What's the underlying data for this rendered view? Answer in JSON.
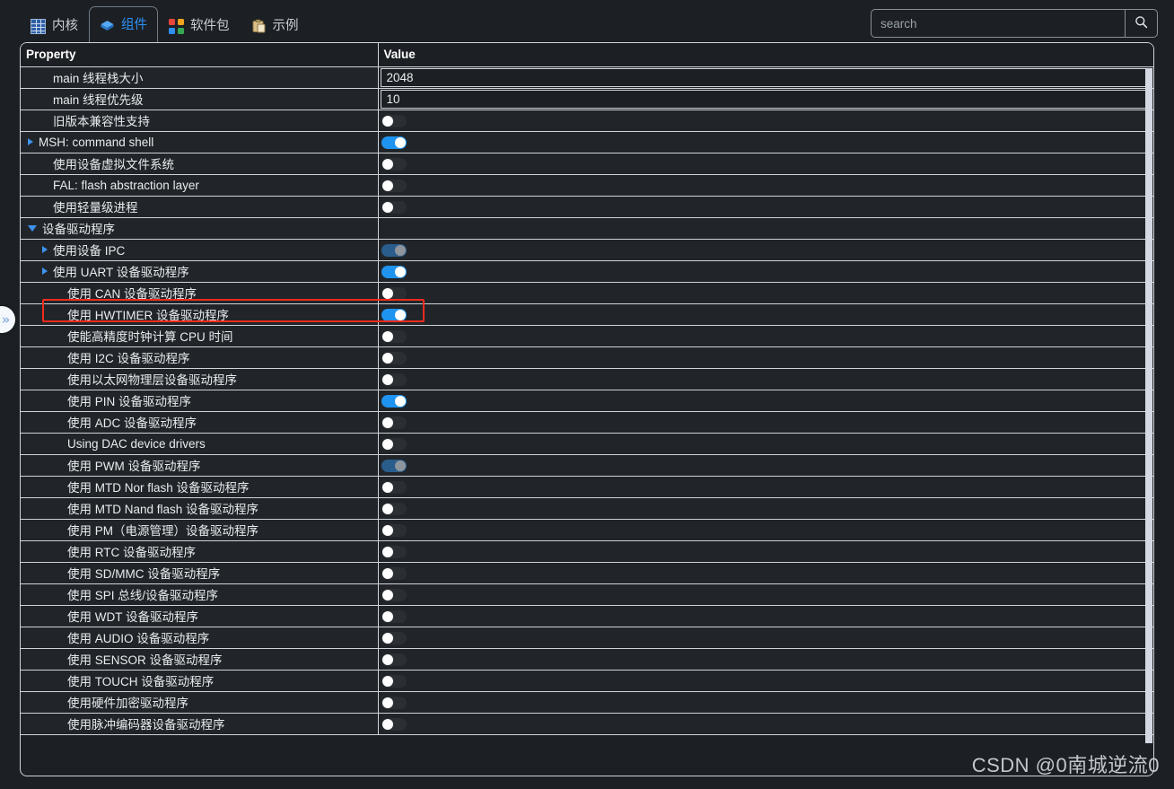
{
  "tabs": [
    {
      "id": "kernel",
      "label": "内核",
      "icon": "grid-icon",
      "active": false
    },
    {
      "id": "components",
      "label": "组件",
      "icon": "cube-icon",
      "active": true
    },
    {
      "id": "packages",
      "label": "软件包",
      "icon": "packages-icon",
      "active": false
    },
    {
      "id": "examples",
      "label": "示例",
      "icon": "clipboard-icon",
      "active": false
    }
  ],
  "search": {
    "placeholder": "search",
    "value": "",
    "button_icon": "search-icon"
  },
  "table": {
    "headers": {
      "property": "Property",
      "value": "Value"
    },
    "rows": [
      {
        "label": "main 线程栈大小",
        "indent": 1,
        "arrow": "none",
        "value_type": "input",
        "value": "2048",
        "selected": false
      },
      {
        "label": "main 线程优先级",
        "indent": 1,
        "arrow": "none",
        "value_type": "input",
        "value": "10",
        "selected": false
      },
      {
        "label": "旧版本兼容性支持",
        "indent": 1,
        "arrow": "none",
        "value_type": "toggle",
        "value": "off",
        "selected": false
      },
      {
        "label": "MSH: command shell",
        "indent": 0,
        "arrow": "right",
        "value_type": "toggle",
        "value": "on",
        "selected": false
      },
      {
        "label": "使用设备虚拟文件系统",
        "indent": 1,
        "arrow": "none",
        "value_type": "toggle",
        "value": "off",
        "selected": false
      },
      {
        "label": "FAL: flash abstraction layer",
        "indent": 1,
        "arrow": "none",
        "value_type": "toggle",
        "value": "off",
        "selected": false
      },
      {
        "label": "使用轻量级进程",
        "indent": 1,
        "arrow": "none",
        "value_type": "toggle",
        "value": "off",
        "selected": false
      },
      {
        "label": "设备驱动程序",
        "indent": 0,
        "arrow": "down",
        "value_type": "none",
        "value": "",
        "selected": true
      },
      {
        "label": "使用设备 IPC",
        "indent": 1,
        "arrow": "right",
        "value_type": "toggle",
        "value": "on-disabled",
        "selected": false
      },
      {
        "label": "使用 UART 设备驱动程序",
        "indent": 1,
        "arrow": "right",
        "value_type": "toggle",
        "value": "on",
        "selected": false
      },
      {
        "label": "使用 CAN 设备驱动程序",
        "indent": 2,
        "arrow": "none",
        "value_type": "toggle",
        "value": "off",
        "selected": false
      },
      {
        "label": "使用 HWTIMER 设备驱动程序",
        "indent": 2,
        "arrow": "none",
        "value_type": "toggle",
        "value": "on",
        "selected": false,
        "highlighted": true
      },
      {
        "label": "使能高精度时钟计算 CPU 时间",
        "indent": 2,
        "arrow": "none",
        "value_type": "toggle",
        "value": "off",
        "selected": false
      },
      {
        "label": "使用 I2C 设备驱动程序",
        "indent": 2,
        "arrow": "none",
        "value_type": "toggle",
        "value": "off",
        "selected": false
      },
      {
        "label": "使用以太网物理层设备驱动程序",
        "indent": 2,
        "arrow": "none",
        "value_type": "toggle",
        "value": "off",
        "selected": false
      },
      {
        "label": "使用 PIN 设备驱动程序",
        "indent": 2,
        "arrow": "none",
        "value_type": "toggle",
        "value": "on",
        "selected": false
      },
      {
        "label": "使用 ADC 设备驱动程序",
        "indent": 2,
        "arrow": "none",
        "value_type": "toggle",
        "value": "off",
        "selected": false
      },
      {
        "label": "Using DAC device drivers",
        "indent": 2,
        "arrow": "none",
        "value_type": "toggle",
        "value": "off",
        "selected": false
      },
      {
        "label": "使用 PWM 设备驱动程序",
        "indent": 2,
        "arrow": "none",
        "value_type": "toggle",
        "value": "on-disabled",
        "selected": false
      },
      {
        "label": "使用 MTD Nor flash 设备驱动程序",
        "indent": 2,
        "arrow": "none",
        "value_type": "toggle",
        "value": "off",
        "selected": false
      },
      {
        "label": "使用 MTD Nand flash 设备驱动程序",
        "indent": 2,
        "arrow": "none",
        "value_type": "toggle",
        "value": "off",
        "selected": false
      },
      {
        "label": "使用 PM（电源管理）设备驱动程序",
        "indent": 2,
        "arrow": "none",
        "value_type": "toggle",
        "value": "off",
        "selected": false
      },
      {
        "label": "使用 RTC 设备驱动程序",
        "indent": 2,
        "arrow": "none",
        "value_type": "toggle",
        "value": "off",
        "selected": false
      },
      {
        "label": "使用 SD/MMC 设备驱动程序",
        "indent": 2,
        "arrow": "none",
        "value_type": "toggle",
        "value": "off",
        "selected": false
      },
      {
        "label": "使用 SPI 总线/设备驱动程序",
        "indent": 2,
        "arrow": "none",
        "value_type": "toggle",
        "value": "off",
        "selected": false
      },
      {
        "label": "使用 WDT 设备驱动程序",
        "indent": 2,
        "arrow": "none",
        "value_type": "toggle",
        "value": "off",
        "selected": false
      },
      {
        "label": "使用 AUDIO 设备驱动程序",
        "indent": 2,
        "arrow": "none",
        "value_type": "toggle",
        "value": "off",
        "selected": false
      },
      {
        "label": "使用 SENSOR 设备驱动程序",
        "indent": 2,
        "arrow": "none",
        "value_type": "toggle",
        "value": "off",
        "selected": false
      },
      {
        "label": "使用 TOUCH 设备驱动程序",
        "indent": 2,
        "arrow": "none",
        "value_type": "toggle",
        "value": "off",
        "selected": false
      },
      {
        "label": "使用硬件加密驱动程序",
        "indent": 2,
        "arrow": "none",
        "value_type": "toggle",
        "value": "off",
        "selected": false
      },
      {
        "label": "使用脉冲编码器设备驱动程序",
        "indent": 2,
        "arrow": "none",
        "value_type": "toggle",
        "value": "off",
        "selected": false
      }
    ]
  },
  "collapse_handle": {
    "icon": "chevron-double-right-icon",
    "glyph": "»"
  },
  "watermark": {
    "text": "CSDN @0南城逆流0"
  },
  "colors": {
    "accent": "#2f8ff5",
    "toggle_on": "#1f93f0",
    "toggle_on_disabled": "#2a5d8c",
    "highlight_box": "#f22b1e",
    "background": "#1c2024",
    "row_background": "#212529",
    "selected_row": "#000000",
    "border": "#cfd4da"
  }
}
